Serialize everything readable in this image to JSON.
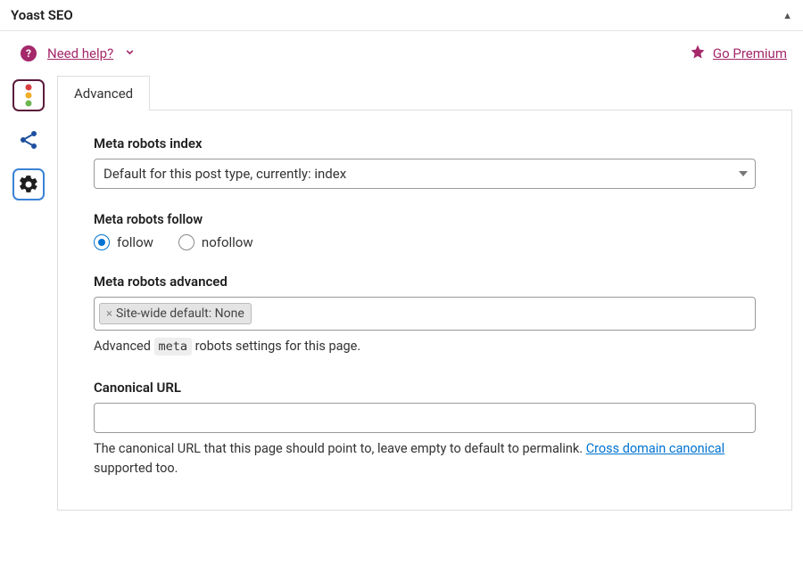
{
  "header": {
    "title": "Yoast SEO"
  },
  "helpBar": {
    "helpLabel": "Need help?",
    "premiumLabel": "Go Premium"
  },
  "tabs": {
    "active": "Advanced"
  },
  "fields": {
    "metaRobotsIndex": {
      "label": "Meta robots index",
      "value": "Default for this post type, currently: index"
    },
    "metaRobotsFollow": {
      "label": "Meta robots follow",
      "options": {
        "follow": "follow",
        "nofollow": "nofollow"
      },
      "selected": "follow"
    },
    "metaRobotsAdvanced": {
      "label": "Meta robots advanced",
      "chip": "Site-wide default: None",
      "helpPrefix": "Advanced ",
      "helpCode": "meta",
      "helpSuffix": " robots settings for this page."
    },
    "canonicalUrl": {
      "label": "Canonical URL",
      "value": "",
      "helpText": "The canonical URL that this page should point to, leave empty to default to permalink. ",
      "linkText": "Cross domain canonical",
      "helpTail": " supported too."
    }
  }
}
